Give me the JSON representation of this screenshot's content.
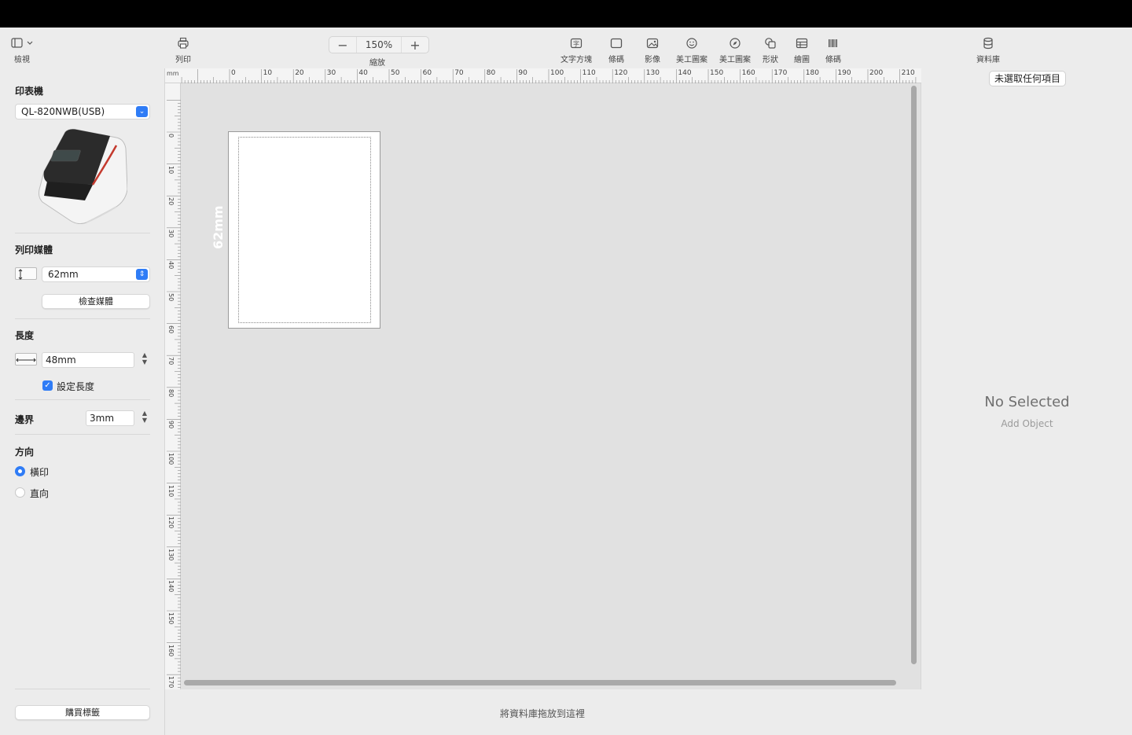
{
  "toolbar": {
    "view_label": "檢視",
    "print_label": "列印",
    "zoom_label": "縮放",
    "zoom_value": "150%",
    "zoom_out": "−",
    "zoom_in": "+",
    "items": [
      {
        "label": "文字方塊",
        "icon": "text-box-icon"
      },
      {
        "label": "條碼",
        "icon": "frame-icon"
      },
      {
        "label": "影像",
        "icon": "image-icon"
      },
      {
        "label": "美工圖案",
        "icon": "emoji-icon"
      },
      {
        "label": "美工圖案",
        "icon": "compass-icon"
      },
      {
        "label": "形狀",
        "icon": "shapes-icon"
      },
      {
        "label": "繪圖",
        "icon": "table-icon"
      },
      {
        "label": "條碼",
        "icon": "barcode-icon"
      }
    ],
    "database_label": "資料庫"
  },
  "sidebar": {
    "printer_title": "印表機",
    "printer_value": "QL-820NWB(USB)",
    "media_title": "列印媒體",
    "media_value": "62mm",
    "check_media_button": "檢查媒體",
    "length_title": "長度",
    "length_value": "48mm",
    "set_length_label": "設定長度",
    "margin_title": "邊界",
    "margin_value": "3mm",
    "orientation_title": "方向",
    "orientation_landscape": "橫印",
    "orientation_portrait": "直向",
    "buy_labels_button": "購買標籤"
  },
  "canvas": {
    "ruler_unit": "mm",
    "top_ticks": [
      "0",
      "10",
      "20",
      "30",
      "40",
      "50",
      "60",
      "70",
      "80",
      "90",
      "100",
      "110",
      "120",
      "130",
      "140",
      "150",
      "160",
      "170",
      "180",
      "190",
      "200",
      "210"
    ],
    "left_ticks": [
      "0",
      "10",
      "20",
      "30",
      "40",
      "50",
      "60",
      "70",
      "80",
      "90",
      "100",
      "110",
      "120",
      "130",
      "140",
      "150",
      "160",
      "170"
    ],
    "media_size_text": "62mm",
    "drop_hint": "將資料庫拖放到這裡"
  },
  "right_panel": {
    "none_selected_button": "未選取任何項目",
    "no_selected_title": "No Selected",
    "add_object_hint": "Add Object"
  }
}
